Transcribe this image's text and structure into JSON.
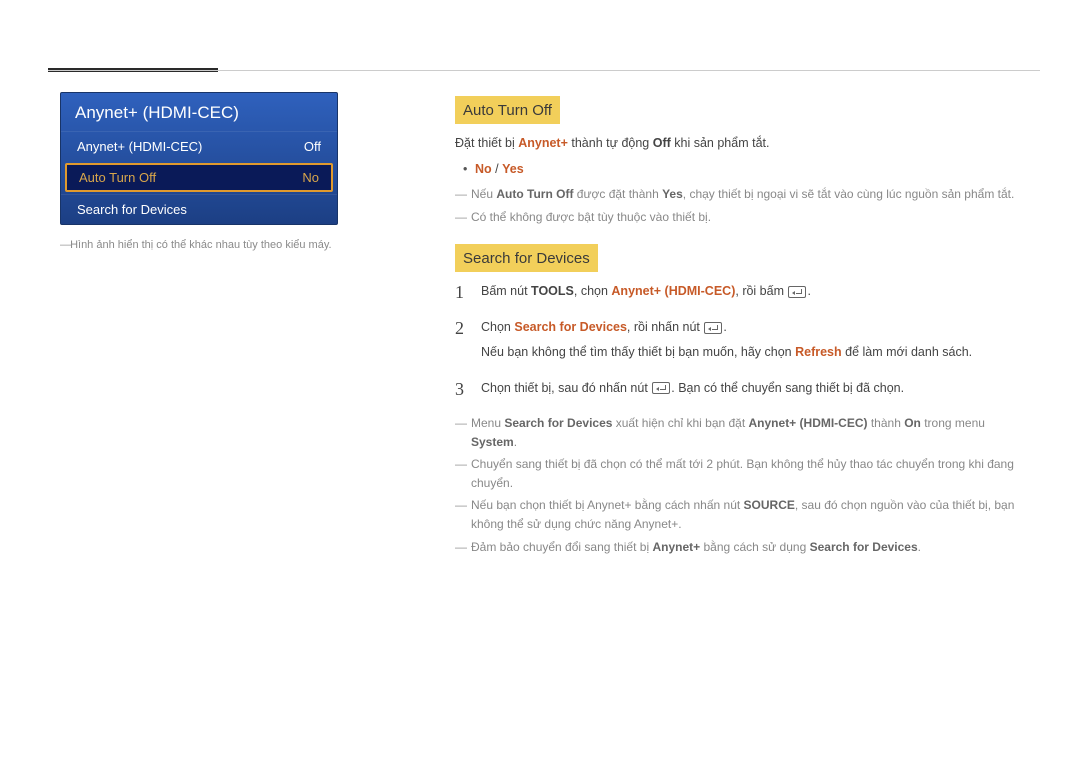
{
  "panel": {
    "title": "Anynet+ (HDMI-CEC)",
    "rows": [
      {
        "label": "Anynet+ (HDMI-CEC)",
        "value": "Off"
      },
      {
        "label": "Auto Turn Off",
        "value": "No"
      },
      {
        "label": "Search for Devices",
        "value": ""
      }
    ],
    "caption": "Hình ảnh hiển thị có thể khác nhau tùy theo kiểu máy."
  },
  "section1": {
    "heading": "Auto Turn Off",
    "intro_pre": "Đặt thiết bị ",
    "intro_hl1": "Anynet+",
    "intro_mid": " thành tự động ",
    "intro_hl2": "Off",
    "intro_post": " khi sản phẩm tắt.",
    "option_no": "No",
    "option_slash": " / ",
    "option_yes": "Yes",
    "note1_pre": "Nếu ",
    "note1_b1": "Auto Turn Off",
    "note1_mid": " được đặt thành ",
    "note1_b2": "Yes",
    "note1_post": ", chạy thiết bị ngoại vi sẽ tắt vào cùng lúc nguồn sản phẩm tắt.",
    "note2": "Có thể không được bật tùy thuộc vào thiết bị."
  },
  "section2": {
    "heading": "Search for Devices",
    "step1_pre": "Bấm nút ",
    "step1_b1": "TOOLS",
    "step1_mid1": ", chọn ",
    "step1_hl": "Anynet+ (HDMI-CEC)",
    "step1_mid2": ", rồi bấm ",
    "step1_post": ".",
    "step2_pre": "Chọn ",
    "step2_hl": "Search for Devices",
    "step2_mid": ", rồi nhấn nút ",
    "step2_post": ".",
    "step2_p2_pre": "Nếu bạn không thể tìm thấy thiết bị bạn muốn, hãy chọn ",
    "step2_p2_hl": "Refresh",
    "step2_p2_post": " để làm mới danh sách.",
    "step3_pre": "Chọn thiết bị, sau đó nhấn nút ",
    "step3_post": ". Bạn có thể chuyển sang thiết bị đã chọn.",
    "n1_a": "Menu ",
    "n1_b": "Search for Devices",
    "n1_c": " xuất hiện chỉ khi bạn đặt ",
    "n1_d": "Anynet+ (HDMI-CEC)",
    "n1_e": " thành ",
    "n1_f": "On",
    "n1_g": " trong menu ",
    "n1_h": "System",
    "n1_i": ".",
    "n2": "Chuyển sang thiết bị đã chọn có thể mất tới 2 phút. Bạn không thể hủy thao tác chuyển trong khi đang chuyển.",
    "n3_a": "Nếu bạn chọn thiết bị Anynet+ bằng cách nhấn nút ",
    "n3_b": "SOURCE",
    "n3_c": ", sau đó chọn nguồn vào của thiết bị, bạn không thể sử dụng chức năng Anynet+.",
    "n4_a": "Đảm bảo chuyển đổi sang thiết bị ",
    "n4_b": "Anynet+",
    "n4_c": " bằng cách sử dụng ",
    "n4_d": "Search for Devices",
    "n4_e": "."
  }
}
